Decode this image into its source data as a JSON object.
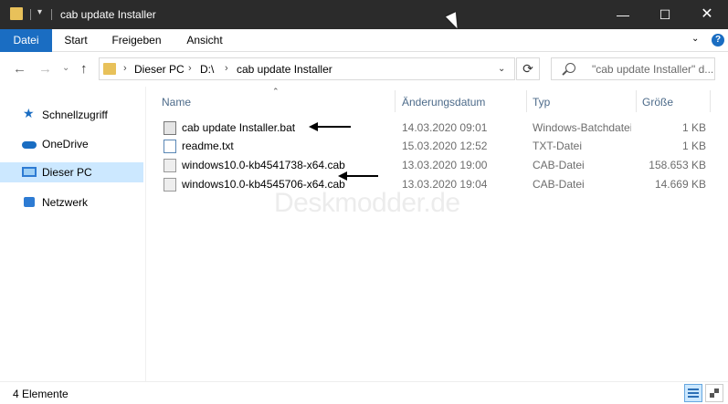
{
  "window": {
    "title": "cab update Installer",
    "minimize": "—",
    "maximize": "☐",
    "close": "✕"
  },
  "ribbon": {
    "tabs": [
      {
        "label": "Datei",
        "active": true
      },
      {
        "label": "Start",
        "active": false
      },
      {
        "label": "Freigeben",
        "active": false
      },
      {
        "label": "Ansicht",
        "active": false
      }
    ],
    "help": "?"
  },
  "address": {
    "parts": [
      "Dieser PC",
      "D:\\",
      "cab update Installer"
    ],
    "separator": "›"
  },
  "search": {
    "placeholder": "\"cab update Installer\" d..."
  },
  "sidebar": {
    "items": [
      {
        "label": "Schnellzugriff",
        "icon": "star-icon"
      },
      {
        "label": "OneDrive",
        "icon": "cloud-icon"
      },
      {
        "label": "Dieser PC",
        "icon": "pc-icon",
        "selected": true
      },
      {
        "label": "Netzwerk",
        "icon": "network-icon"
      }
    ]
  },
  "columns": {
    "name": "Name",
    "date": "Änderungsdatum",
    "type": "Typ",
    "size": "Größe"
  },
  "files": [
    {
      "name": "cab update Installer.bat",
      "date": "14.03.2020 09:01",
      "type": "Windows-Batchdatei",
      "size": "1 KB",
      "icon": "batch-file-icon"
    },
    {
      "name": "readme.txt",
      "date": "15.03.2020 12:52",
      "type": "TXT-Datei",
      "size": "1 KB",
      "icon": "text-file-icon"
    },
    {
      "name": "windows10.0-kb4541738-x64.cab",
      "date": "13.03.2020 19:00",
      "type": "CAB-Datei",
      "size": "158.653 KB",
      "icon": "cab-file-icon"
    },
    {
      "name": "windows10.0-kb4545706-x64.cab",
      "date": "13.03.2020 19:04",
      "type": "CAB-Datei",
      "size": "14.669 KB",
      "icon": "cab-file-icon"
    }
  ],
  "watermark": "Deskmodder.de",
  "status": {
    "count": "4 Elemente"
  },
  "colors": {
    "titlebar": "#2b2b2b",
    "accent": "#1a6dc2",
    "selection": "#cce8ff"
  }
}
